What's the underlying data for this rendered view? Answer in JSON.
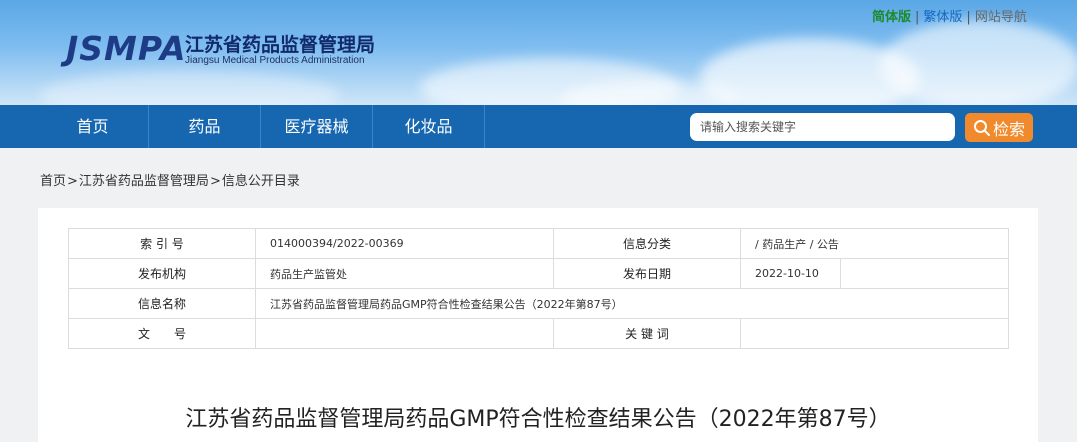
{
  "header": {
    "logo_mark": "JSMPA",
    "logo_cn": "江苏省药品监督管理局",
    "logo_en": "Jiangsu Medical Products Administration",
    "lang": {
      "simplified": "简体版",
      "traditional": "繁体版",
      "sitemap": "网站导航",
      "separator": "|"
    }
  },
  "nav": {
    "items": [
      {
        "label": "首页"
      },
      {
        "label": "药品"
      },
      {
        "label": "医疗器械"
      },
      {
        "label": "化妆品"
      }
    ],
    "search": {
      "placeholder": "请输入搜索关键字",
      "button_label": "检索"
    }
  },
  "breadcrumb": {
    "items": [
      "首页",
      "江苏省药品监督管理局",
      "信息公开目录"
    ],
    "separator": ">"
  },
  "info_table": {
    "index_label": "索 引 号",
    "index_value": "014000394/2022-00369",
    "category_label": "信息分类",
    "category_value": "/ 药品生产 / 公告",
    "publisher_label": "发布机构",
    "publisher_value": "药品生产监管处",
    "date_label": "发布日期",
    "date_value": "2022-10-10",
    "name_label": "信息名称",
    "name_value": "江苏省药品监督管理局药品GMP符合性检查结果公告（2022年第87号）",
    "docno_label": "文　　号",
    "docno_value": "",
    "keywords_label": "关 键 词",
    "keywords_value": ""
  },
  "document": {
    "title": "江苏省药品监督管理局药品GMP符合性检查结果公告（2022年第87号）"
  },
  "colors": {
    "nav_bg": "#1666b0",
    "search_button": "#f08a2c",
    "logo": "#1e3c86",
    "simplified_link": "#1d8a2e",
    "traditional_link": "#1568c0"
  }
}
